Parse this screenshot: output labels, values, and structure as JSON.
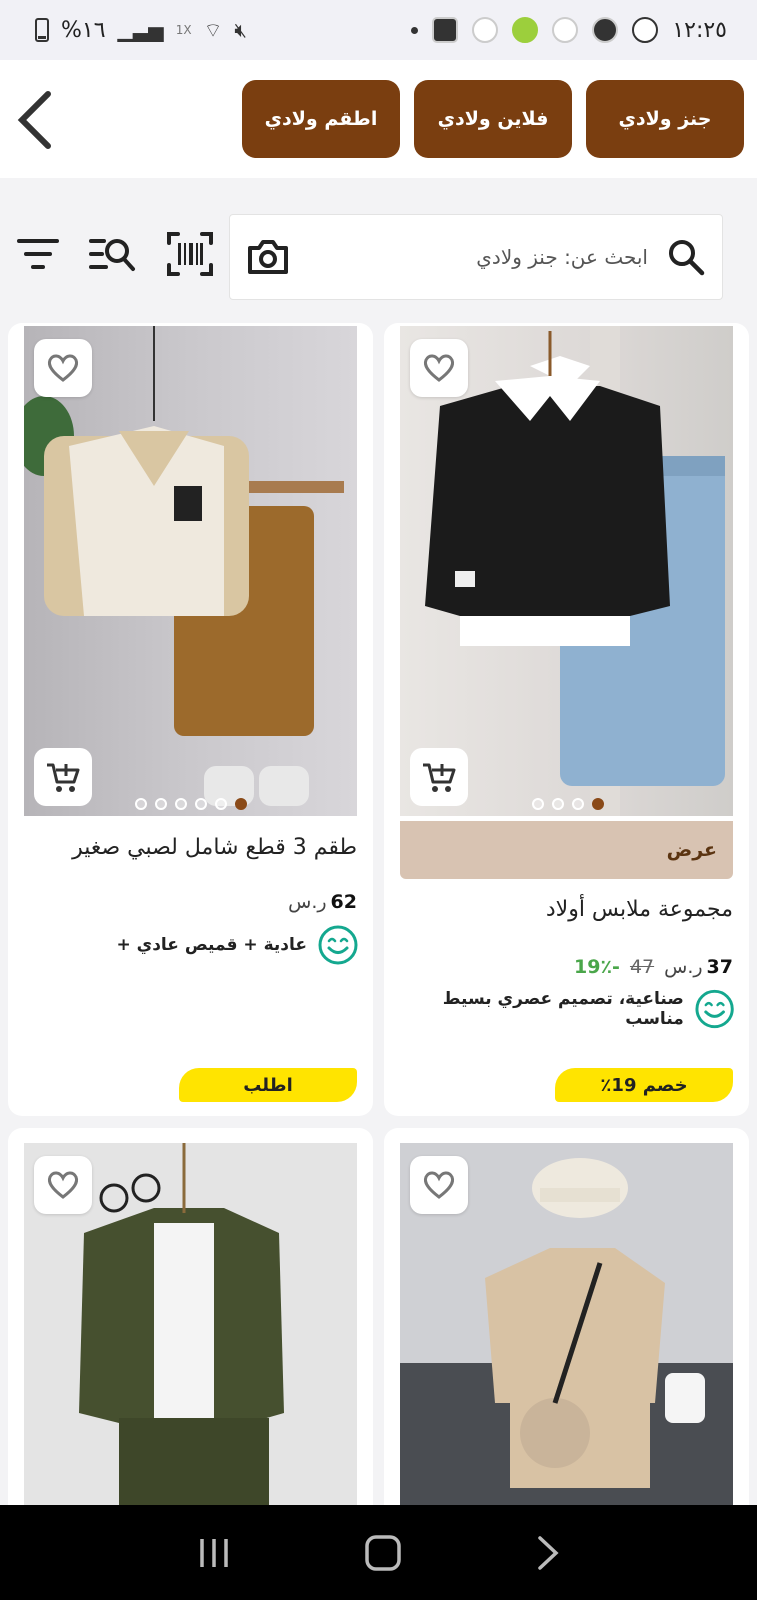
{
  "status_bar": {
    "time": "١٢:٢٥",
    "battery": "%١٦",
    "signal_speed": "1X"
  },
  "categories": [
    {
      "label": "جنز ولادي"
    },
    {
      "label": "فلاين ولادي"
    },
    {
      "label": "اطقم ولادي"
    }
  ],
  "search": {
    "prefix": "ابحث عن:",
    "query": "جنز ولادي"
  },
  "products": [
    {
      "title": "مجموعة ملابس أولاد",
      "offer_label": "عرض",
      "price": "37",
      "currency": "ر.س",
      "old_price": "47",
      "discount": "-19٪",
      "feature": "صناعية، تصميم عصري بسيط مناسب",
      "cta": "خصم 19٪",
      "image_dots": 4,
      "active_dot": 3
    },
    {
      "title": "طقم 3 قطع شامل لصبي صغير",
      "price": "62",
      "currency": "ر.س",
      "feature": "عادية + قميص عادي +",
      "cta": "اطلب",
      "image_dots": 6,
      "active_dot": 5
    }
  ],
  "colors": {
    "brand_brown": "#7a3e10",
    "offer_beige": "#d8c3b2",
    "cta_yellow": "#ffe400",
    "discount_green": "#4aa64a",
    "smile_teal": "#14a88f"
  }
}
